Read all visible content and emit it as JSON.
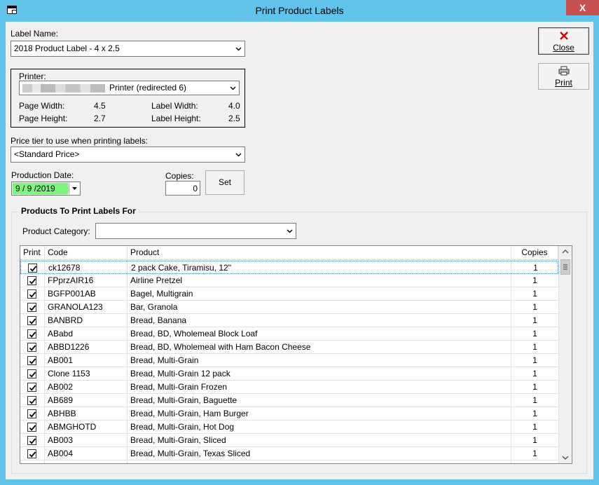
{
  "window": {
    "title": "Print Product Labels",
    "close_glyph": "X"
  },
  "label_name": {
    "label": "Label Name:",
    "value": "2018 Product Label - 4 x 2.5"
  },
  "printer": {
    "label": "Printer:",
    "value": "Printer (redirected 6)",
    "page_width_label": "Page Width:",
    "page_width": "4.5",
    "page_height_label": "Page Height:",
    "page_height": "2.7",
    "label_width_label": "Label Width:",
    "label_width": "4.0",
    "label_height_label": "Label Height:",
    "label_height": "2.5"
  },
  "price_tier": {
    "label": "Price tier to use when printing labels:",
    "value": "<Standard Price>"
  },
  "production_date": {
    "label": "Production Date:",
    "value": "9 / 9 /2019"
  },
  "copies": {
    "label": "Copies:",
    "value": "0"
  },
  "buttons": {
    "set": "Set",
    "close": "Close",
    "print": "Print"
  },
  "products": {
    "group_title": "Products To Print Labels For",
    "category_label": "Product Category:",
    "category_value": "",
    "headers": {
      "print": "Print",
      "code": "Code",
      "product": "Product",
      "copies": "Copies"
    },
    "rows": [
      {
        "code": "ck12678",
        "product": "2 pack Cake, Tiramisu, 12\"",
        "copies": "1",
        "checked": true
      },
      {
        "code": "FPprzAIR16",
        "product": "Airline Pretzel",
        "copies": "1",
        "checked": true
      },
      {
        "code": "BGFP001AB",
        "product": "Bagel, Multigrain",
        "copies": "1",
        "checked": true
      },
      {
        "code": "GRANOLA123",
        "product": "Bar, Granola",
        "copies": "1",
        "checked": true
      },
      {
        "code": "BANBRD",
        "product": "Bread, Banana",
        "copies": "1",
        "checked": true
      },
      {
        "code": "ABabd",
        "product": "Bread, BD, Wholemeal Block Loaf",
        "copies": "1",
        "checked": true
      },
      {
        "code": "ABBD1226",
        "product": "Bread, BD, Wholemeal with Ham Bacon Cheese",
        "copies": "1",
        "checked": true
      },
      {
        "code": "AB001",
        "product": "Bread, Multi-Grain",
        "copies": "1",
        "checked": true
      },
      {
        "code": "Clone 1153",
        "product": "Bread, Multi-Grain 12 pack",
        "copies": "1",
        "checked": true
      },
      {
        "code": "AB002",
        "product": "Bread, Multi-Grain Frozen",
        "copies": "1",
        "checked": true
      },
      {
        "code": "AB689",
        "product": "Bread, Multi-Grain, Baguette",
        "copies": "1",
        "checked": true
      },
      {
        "code": "ABHBB",
        "product": "Bread, Multi-Grain, Ham Burger",
        "copies": "1",
        "checked": true
      },
      {
        "code": "ABMGHOTD",
        "product": "Bread, Multi-Grain, Hot Dog",
        "copies": "1",
        "checked": true
      },
      {
        "code": "AB003",
        "product": "Bread, Multi-Grain, Sliced",
        "copies": "1",
        "checked": true
      },
      {
        "code": "AB004",
        "product": "Bread, Multi-Grain, Texas Sliced",
        "copies": "1",
        "checked": true
      }
    ]
  }
}
